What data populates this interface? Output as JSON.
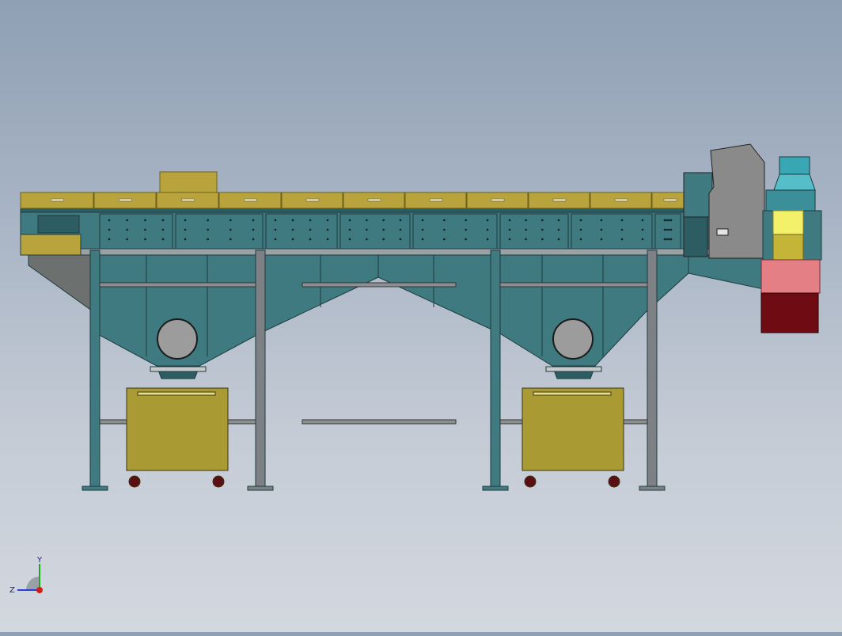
{
  "view": {
    "background_top": "#8f9fb4",
    "background_bottom": "#d3d8df"
  },
  "colors": {
    "frame_teal": "#3e7a80",
    "frame_teal_dark": "#2d5d62",
    "deck_gold": "#b8a33c",
    "deck_gold_dark": "#6e611c",
    "bin_olive": "#a99a34",
    "steel_gray": "#7d8084",
    "steel_gray_dark": "#4f5255",
    "motor_gray": "#8a8a8a",
    "cyan_hood": "#39a7b3",
    "yellow_block": "#f3f06a",
    "pink_panel": "#e47f86",
    "maroon_base": "#6e0b13"
  },
  "triad": {
    "y_label": "Y",
    "z_label": "Z",
    "y_color": "#1fa81f",
    "z_color": "#2a3fd6",
    "x_color": "#d21b1b"
  }
}
